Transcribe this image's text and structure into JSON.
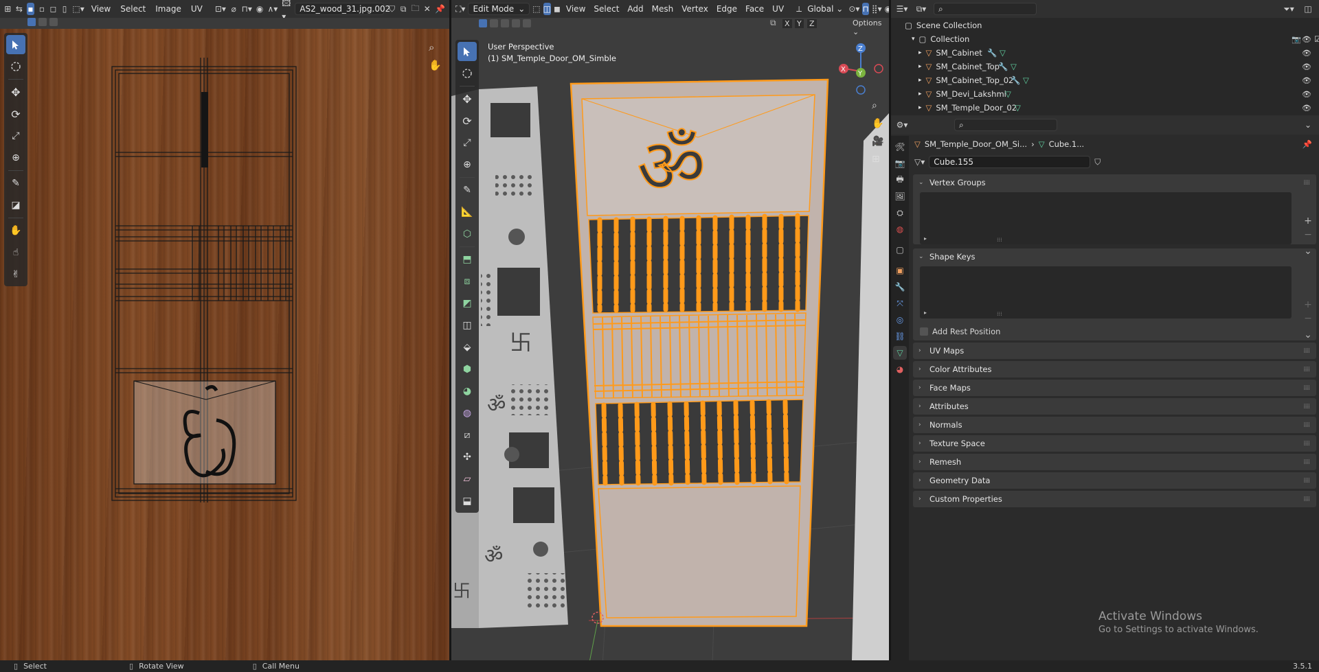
{
  "image_editor": {
    "menus": [
      "View",
      "Select",
      "Image",
      "UV"
    ],
    "image_name": "AS2_wood_31.jpg.002"
  },
  "viewport": {
    "mode": "Edit Mode",
    "menus": [
      "View",
      "Select",
      "Add",
      "Mesh",
      "Vertex",
      "Edge",
      "Face",
      "UV"
    ],
    "orientation": "Global",
    "axes": [
      "X",
      "Y",
      "Z"
    ],
    "options_label": "Options",
    "perspective_label": "User Perspective",
    "object_label": "(1) SM_Temple_Door_OM_Simble",
    "gizmo": {
      "x": "X",
      "y": "Y",
      "z": "Z"
    }
  },
  "outliner": {
    "scene_collection": "Scene Collection",
    "collection": "Collection",
    "items": [
      "SM_Cabinet",
      "SM_Cabinet_Top",
      "SM_Cabinet_Top_02",
      "SM_Devi_Lakshmi",
      "SM_Temple_Door_02"
    ]
  },
  "properties": {
    "breadcrumb_object": "SM_Temple_Door_OM_Si...",
    "breadcrumb_mesh": "Cube.1...",
    "mesh_name": "Cube.155",
    "vertex_groups": "Vertex Groups",
    "shape_keys": "Shape Keys",
    "add_rest_position": "Add Rest Position",
    "collapsed_panels": [
      "UV Maps",
      "Color Attributes",
      "Face Maps",
      "Attributes",
      "Normals",
      "Texture Space",
      "Remesh",
      "Geometry Data",
      "Custom Properties"
    ]
  },
  "watermark": {
    "title": "Activate Windows",
    "subtitle": "Go to Settings to activate Windows."
  },
  "status_bar": {
    "select": "Select",
    "rotate_view": "Rotate View",
    "call_menu": "Call Menu",
    "version": "3.5.1"
  },
  "colors": {
    "accent": "#4772b3",
    "selection": "#ff9a1a",
    "panel": "#303030",
    "background": "#1d1d1d",
    "viewport_bg": "#3d3d3d",
    "wood": "#7a4522"
  }
}
